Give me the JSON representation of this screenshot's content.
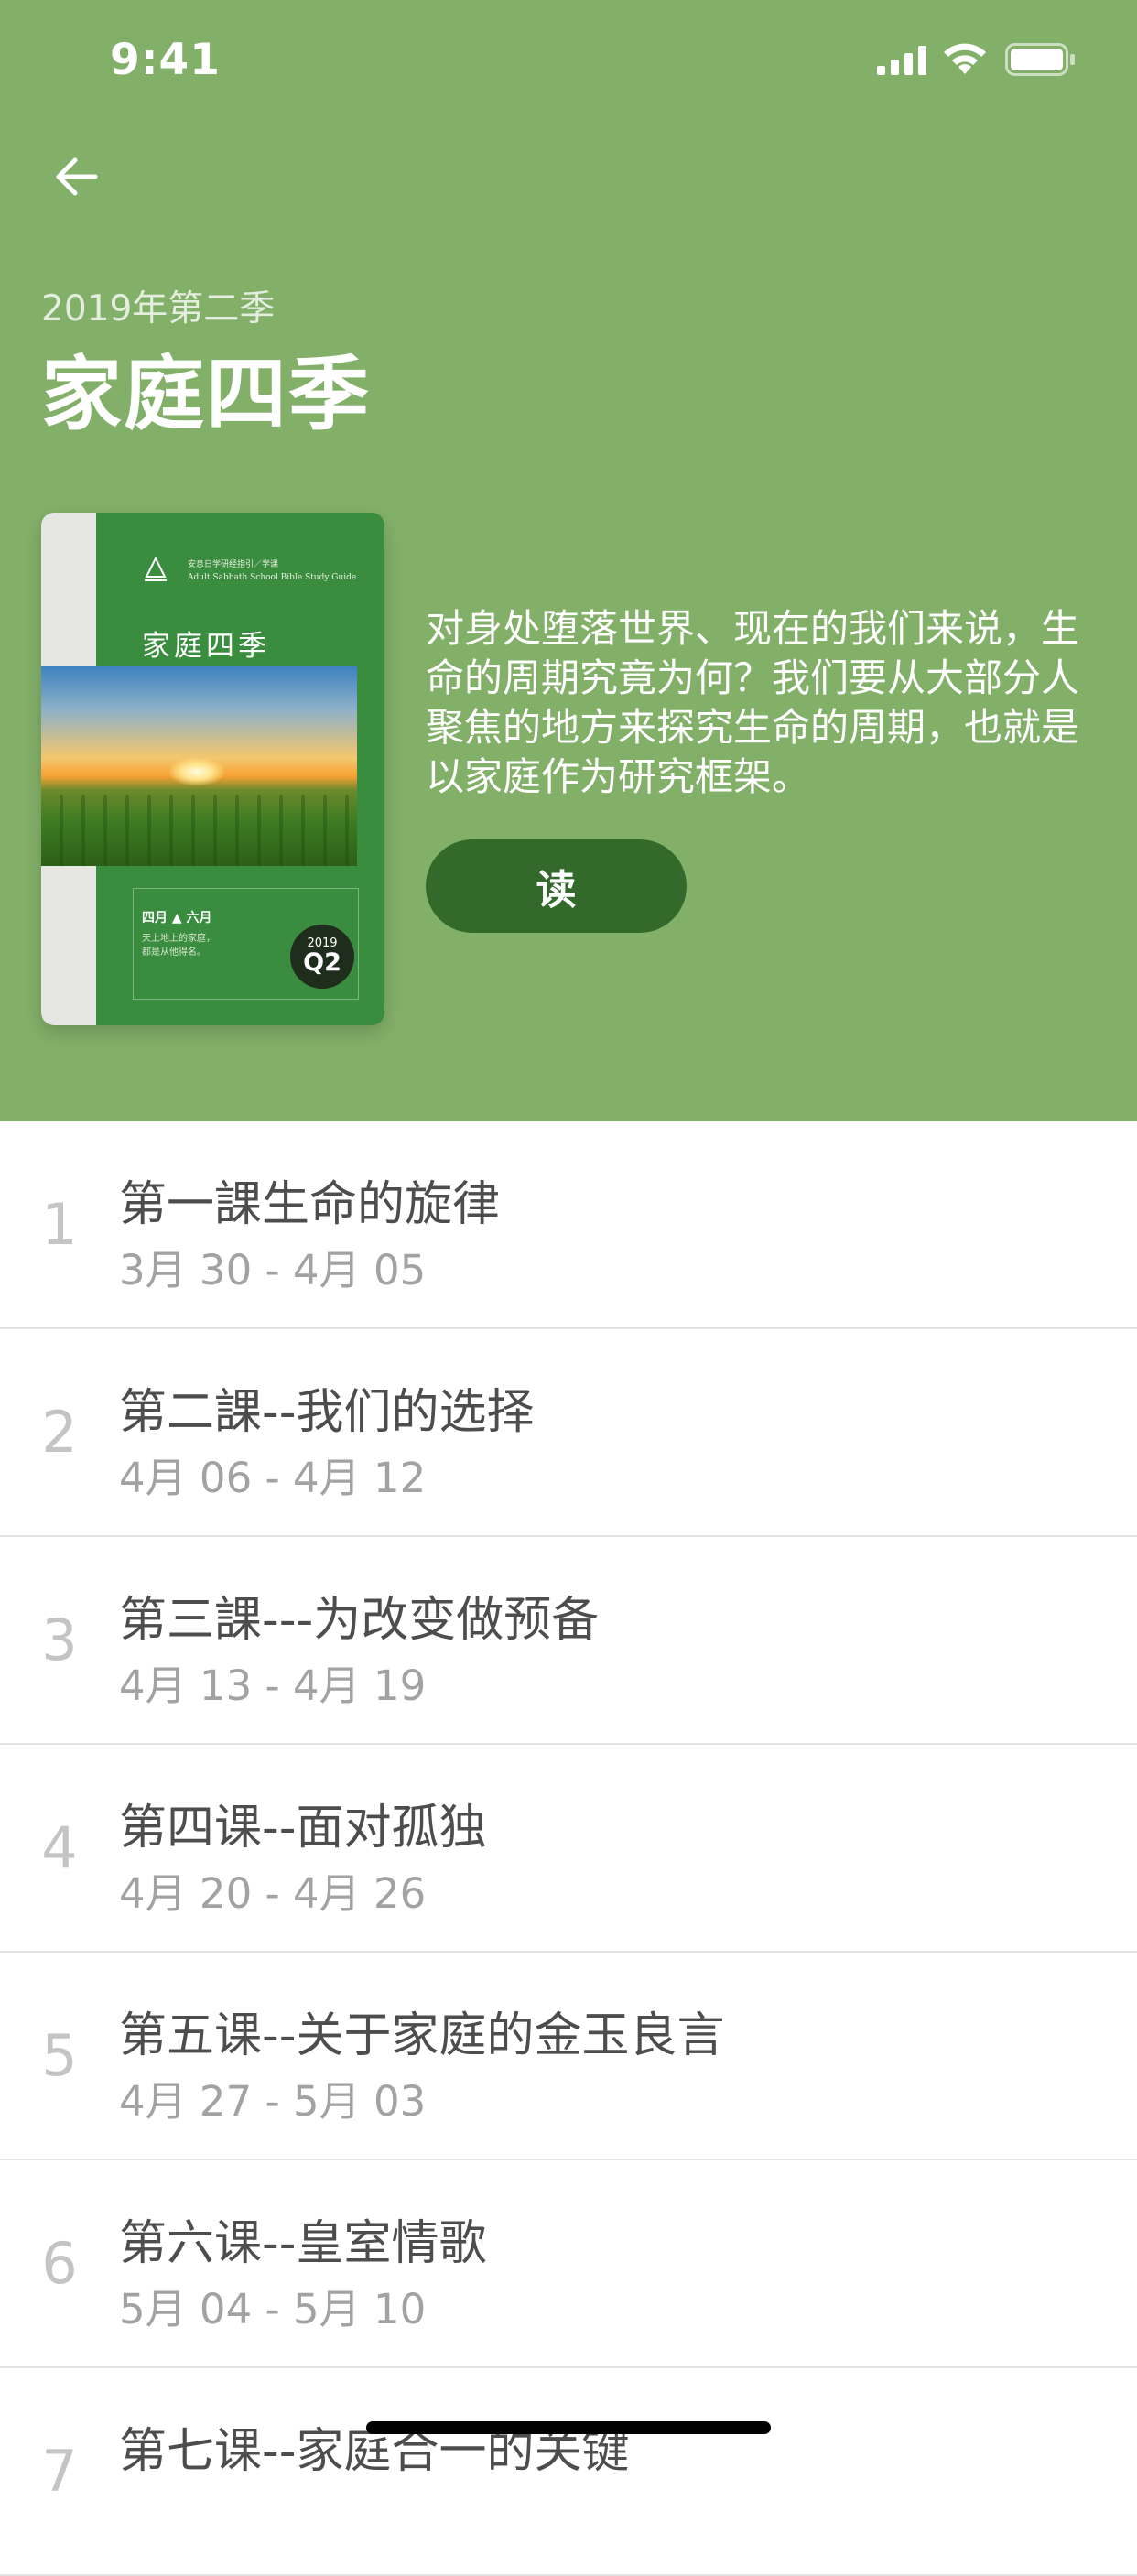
{
  "status_bar": {
    "time": "9:41"
  },
  "header": {
    "quarter_label": "2019年第二季",
    "title": "家庭四季",
    "description": "对身处堕落世界、现在的我们来说，生命的周期究竟为何？我们要从大部分人聚焦的地方来探究生命的周期，也就是以家庭作为研究框架。",
    "read_label": "读",
    "colors": {
      "header_bg": "#83b069",
      "button_bg": "#336a2c"
    }
  },
  "cover": {
    "publisher_line1": "安息日学研经指引／学课",
    "publisher_line2": "Adult Sabbath School Bible Study Guide",
    "title": "家庭四季",
    "months": "四月 ▲ 六月",
    "verse_line1": "天上地上的家庭，",
    "verse_line2": "都是从他得名。",
    "badge_year": "2019",
    "badge_quarter": "Q2"
  },
  "lessons": [
    {
      "number": "1",
      "title": "第一課生命的旋律",
      "date": "3月 30 - 4月 05"
    },
    {
      "number": "2",
      "title": "第二課--我们的选择",
      "date": "4月 06 - 4月 12"
    },
    {
      "number": "3",
      "title": "第三課---为改变做预备",
      "date": "4月 13 - 4月 19"
    },
    {
      "number": "4",
      "title": "第四课--面对孤独",
      "date": "4月 20 - 4月 26"
    },
    {
      "number": "5",
      "title": "第五课--关于家庭的金玉良言",
      "date": "4月 27 - 5月 03"
    },
    {
      "number": "6",
      "title": "第六课--皇室情歌",
      "date": "5月 04 - 5月 10"
    },
    {
      "number": "7",
      "title": "第七课--家庭合一的关键",
      "date": ""
    }
  ]
}
